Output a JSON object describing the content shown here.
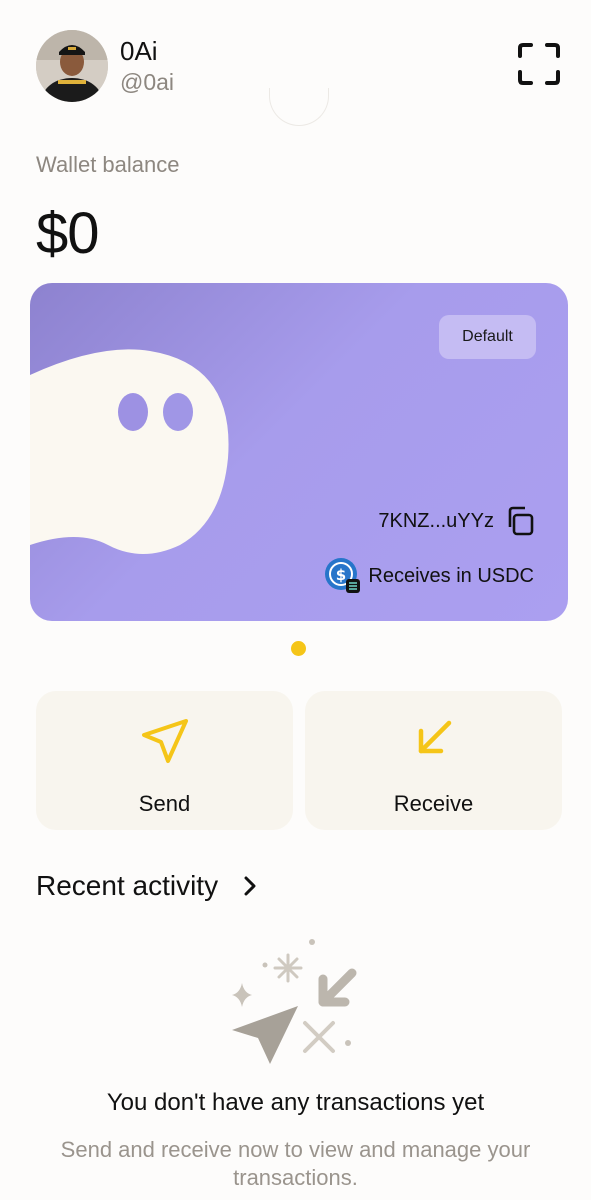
{
  "profile": {
    "name": "0Ai",
    "handle": "@0ai",
    "avatar_icon": "user-avatar-photo"
  },
  "header": {
    "scan_icon": "scan-frame-icon"
  },
  "balance": {
    "label": "Wallet balance",
    "value": "$0"
  },
  "card": {
    "badge": "Default",
    "address": "7KNZ...uYYz",
    "currency_text": "Receives in USDC",
    "colors": {
      "start": "#8d82cf",
      "end": "#ab9ff0",
      "ghost": "#fbf8f1"
    }
  },
  "carousel": {
    "pages": 1,
    "active_page": 1,
    "dot_color": "#f5c518"
  },
  "actions": {
    "send_label": "Send",
    "receive_label": "Receive",
    "accent": "#f5c518"
  },
  "recent": {
    "title": "Recent activity",
    "empty_title": "You don't have any transactions yet",
    "empty_subtitle": "Send and receive now to view and manage your transactions."
  }
}
